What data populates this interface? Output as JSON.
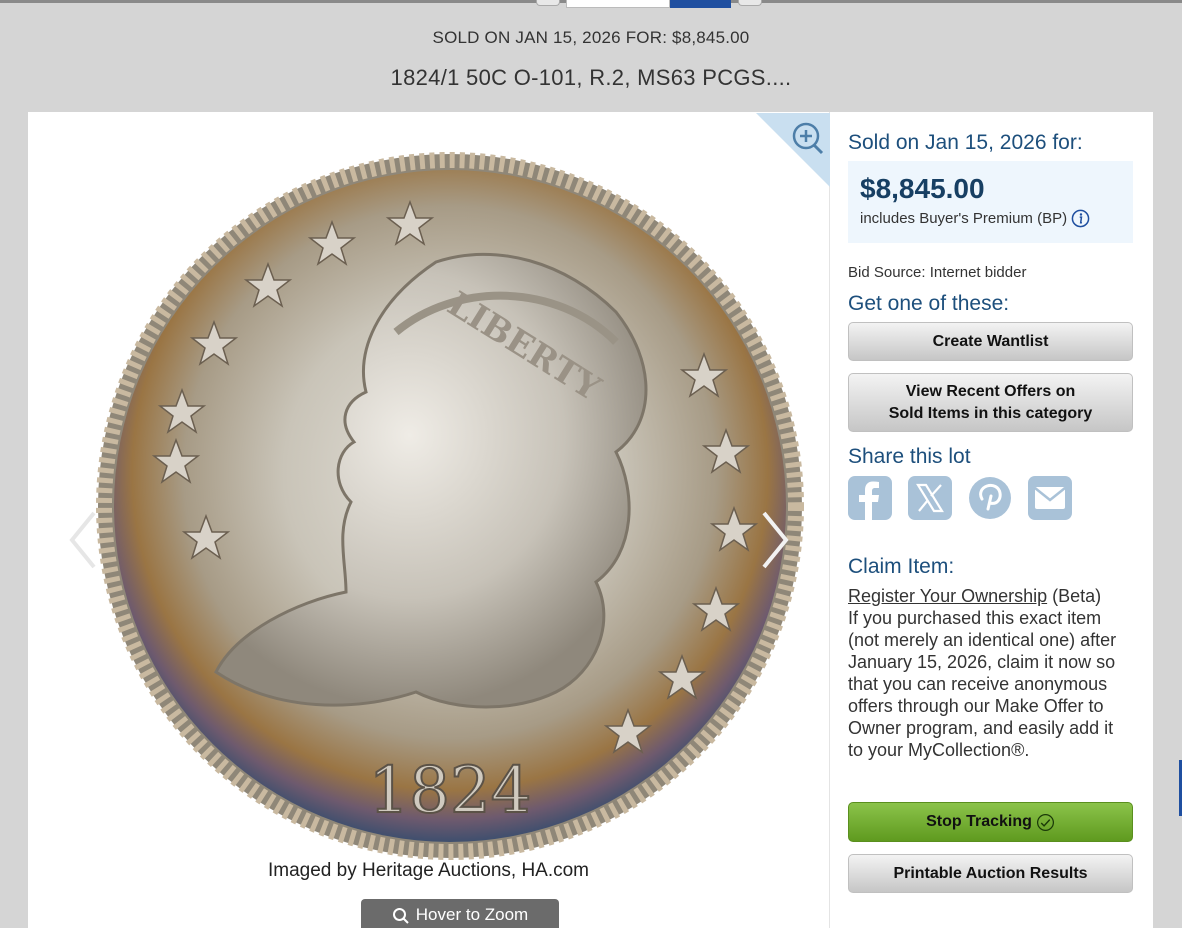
{
  "header": {
    "sold_line": "SOLD ON JAN 15, 2026 FOR: $8,845.00",
    "lot_title": "1824/1 50C O-101, R.2, MS63 PCGS...."
  },
  "image": {
    "credit": "Imaged by Heritage Auctions, HA.com",
    "hover_zoom_label": "Hover to Zoom",
    "coin_legend": "LIBERTY",
    "coin_date": "1824",
    "icons": [
      "zoom-in-icon",
      "chevron-left-icon",
      "chevron-right-icon",
      "search-icon"
    ]
  },
  "sidebar": {
    "sold_header": "Sold on Jan 15, 2026 for:",
    "price": "$8,845.00",
    "bp_note": "includes Buyer's Premium (BP)",
    "bid_source": "Bid Source: Internet bidder",
    "get_one_header": "Get one of these:",
    "create_wantlist": "Create Wantlist",
    "view_offers_line1": "View Recent Offers on",
    "view_offers_line2": "Sold Items in this category",
    "share_header": "Share this lot",
    "share_icons": [
      "facebook-icon",
      "x-icon",
      "pinterest-icon",
      "email-icon"
    ],
    "claim_header": "Claim Item:",
    "claim_link": "Register Your Ownership",
    "claim_beta": " (Beta)",
    "claim_text": "If you purchased this exact item (not merely an identical one) after January 15, 2026, claim it now so that you can receive anonymous offers through our Make Offer to Owner program, and easily add it to your MyCollection®.",
    "stop_tracking": "Stop Tracking",
    "printable_results": "Printable Auction Results"
  },
  "colors": {
    "accent_blue": "#1d4f7c",
    "price_box_bg": "#eef6fd",
    "stop_green": "#7cb342",
    "share_icon": "#a9c2d8"
  }
}
